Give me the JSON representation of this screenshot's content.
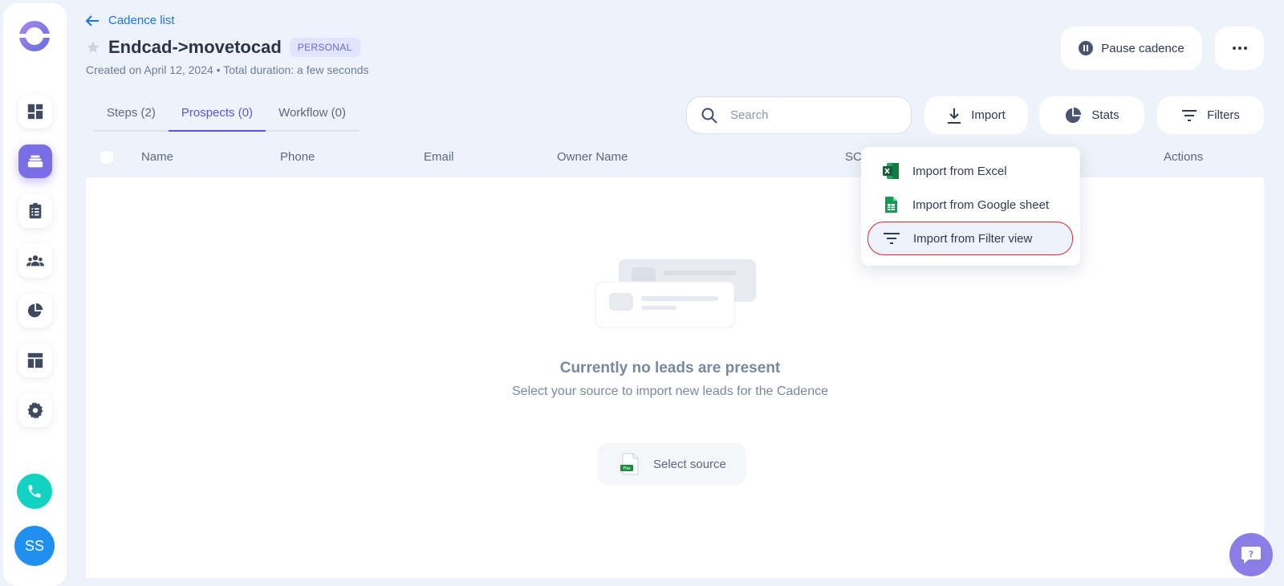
{
  "sidebar": {
    "avatar_initials": "SS",
    "items": [
      {
        "name": "dashboard-icon"
      },
      {
        "name": "cadence-icon",
        "active": true
      },
      {
        "name": "tasks-icon"
      },
      {
        "name": "people-icon"
      },
      {
        "name": "stats-icon"
      },
      {
        "name": "templates-icon"
      },
      {
        "name": "settings-icon"
      }
    ]
  },
  "header": {
    "back_label": "Cadence list",
    "title": "Endcad->movetocad",
    "badge": "PERSONAL",
    "subtitle": "Created on April 12, 2024 • Total duration: a few seconds",
    "pause_label": "Pause cadence"
  },
  "tabs": [
    {
      "label": "Steps (2)",
      "active": false
    },
    {
      "label": "Prospects (0)",
      "active": true
    },
    {
      "label": "Workflow (0)",
      "active": false
    }
  ],
  "toolbar": {
    "search_placeholder": "Search",
    "import_label": "Import",
    "stats_label": "Stats",
    "filters_label": "Filters"
  },
  "table": {
    "columns": [
      "Name",
      "Phone",
      "Email",
      "Owner Name",
      "SC",
      "Actions"
    ]
  },
  "empty_state": {
    "title": "Currently no leads are present",
    "subtitle": "Select your source to import new leads for the Cadence",
    "button_label": "Select source",
    "file_label": "File"
  },
  "import_menu": {
    "items": [
      {
        "label": "Import from Excel",
        "icon": "excel-icon"
      },
      {
        "label": "Import from Google sheet",
        "icon": "google-sheet-icon"
      },
      {
        "label": "Import from Filter view",
        "icon": "filter-view-icon",
        "highlighted": true
      }
    ]
  },
  "colors": {
    "accent": "#5a55d6",
    "link": "#1a73e8",
    "highlight_border": "#e0262b",
    "phone": "#12d3c2"
  }
}
